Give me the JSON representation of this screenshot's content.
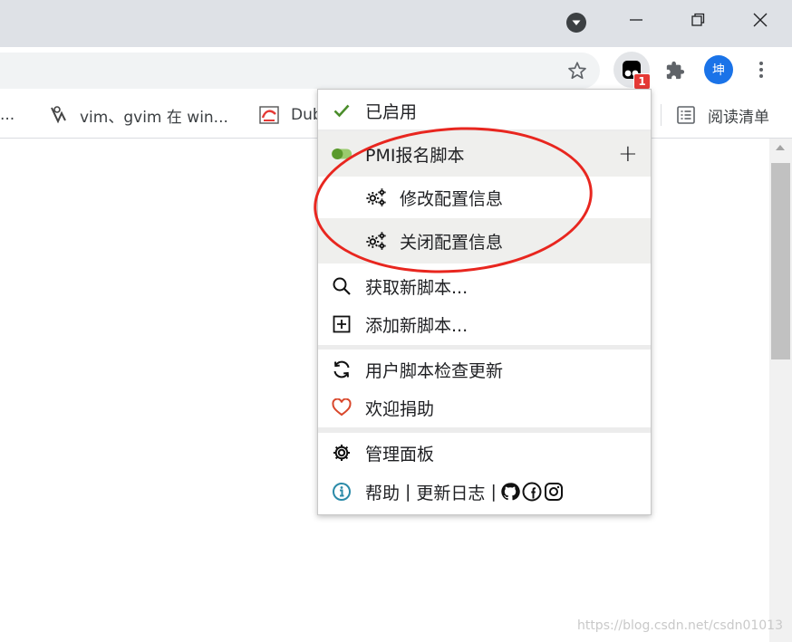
{
  "window": {
    "profile_avatar_text": "坤",
    "extension_badge": "1"
  },
  "bookmarks": {
    "items": [
      {
        "label": "..."
      },
      {
        "label": "vim、gvim 在 win..."
      },
      {
        "label": "Dub"
      }
    ],
    "reading_list": "阅读清单"
  },
  "menu": {
    "enabled": "已启用",
    "script_name": "PMI报名脚本",
    "add_symbol": "+",
    "commands": [
      {
        "label": "修改配置信息"
      },
      {
        "label": "关闭配置信息"
      }
    ],
    "find_scripts": "获取新脚本...",
    "add_script": "添加新脚本...",
    "check_updates": "用户脚本检查更新",
    "donate": "欢迎捐助",
    "dashboard": "管理面板",
    "help": "帮助",
    "pipe": "|",
    "changelog": "更新日志"
  },
  "watermark": "https://blog.csdn.net/csdn01013",
  "colors": {
    "titlebar": "#dee1e6",
    "check_green": "#4a8d2a",
    "toggle_green": "#5a9a2c",
    "heart_red": "#d9472b",
    "info_teal": "#2a8aa8",
    "annotation_red": "#e8261f",
    "avatar_blue": "#1a73e8",
    "badge_red": "#e53935"
  },
  "icons": {
    "titlebar": [
      "dropdown-circle-icon",
      "minimize-icon",
      "restore-icon",
      "close-icon"
    ],
    "toolbar": [
      "star-icon",
      "tampermonkey-icon",
      "puzzle-icon",
      "avatar",
      "kebab-menu-icon"
    ]
  }
}
